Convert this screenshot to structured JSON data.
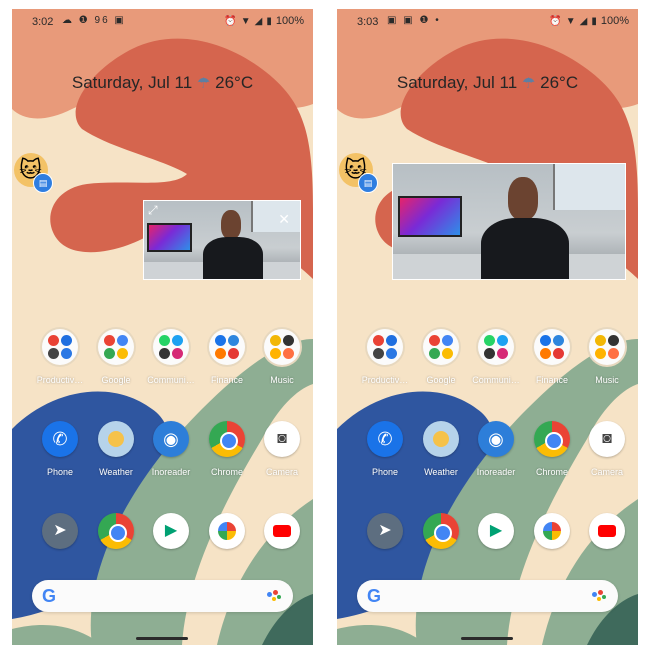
{
  "screens": [
    {
      "status": {
        "time": "3:02",
        "notif_icons": "☁ ❶ 96 ▣",
        "battery": "100%"
      },
      "glance": {
        "date": "Saturday, Jul 11",
        "weather_icon": "☂",
        "temp": "26°C"
      },
      "pip": {
        "state": "with-controls",
        "fullscreen_icon": "⤢",
        "close_icon": "✕"
      }
    },
    {
      "status": {
        "time": "3:03",
        "notif_icons": "▣ ▣ ❶ •",
        "battery": "100%"
      },
      "glance": {
        "date": "Saturday, Jul 11",
        "weather_icon": "☂",
        "temp": "26°C"
      },
      "pip": {
        "state": "expanded"
      }
    }
  ],
  "folders": [
    {
      "label": "Productiv…"
    },
    {
      "label": "Google"
    },
    {
      "label": "Communi…"
    },
    {
      "label": "Finance"
    },
    {
      "label": "Music"
    }
  ],
  "apps_row1": [
    {
      "label": "Phone",
      "icon": "phone-icon"
    },
    {
      "label": "Weather",
      "icon": "weather-icon"
    },
    {
      "label": "Inoreader",
      "icon": "inoreader-icon"
    },
    {
      "label": "Chrome",
      "icon": "chrome-icon"
    },
    {
      "label": "Camera",
      "icon": "camera-icon"
    }
  ],
  "dock": [
    {
      "icon": "telegram-icon"
    },
    {
      "icon": "chrome-icon"
    },
    {
      "icon": "play-store-icon"
    },
    {
      "icon": "photos-icon"
    },
    {
      "icon": "youtube-icon"
    }
  ],
  "search": {
    "logo": "G"
  },
  "colors": {
    "bg_cream": "#f6e3c6",
    "orange_blob": "#d5654e",
    "light_orange": "#e89a7a",
    "green_blob": "#8eae93",
    "blue_blob": "#2f56a0",
    "dark_green": "#3f6a5c"
  }
}
